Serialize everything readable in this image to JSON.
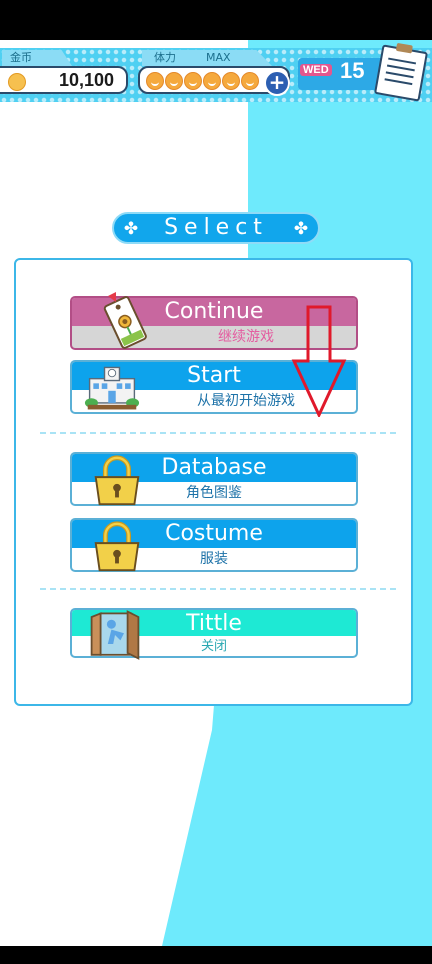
{
  "hud": {
    "coin_label": "金币",
    "coin_value": "10,100",
    "stamina_label": "体力",
    "stamina_max": "MAX",
    "stamina_filled": 6,
    "stamina_add": "+",
    "weekday": "WED",
    "day": "15",
    "memo_icon": "notepad-icon"
  },
  "select": {
    "title": "Select",
    "icon": "flower-icon"
  },
  "menu": {
    "continue_title": "Continue",
    "continue_sub": "继续游戏",
    "start_title": "Start",
    "start_sub": "从最初开始游戏",
    "database_title": "Database",
    "database_sub": "角色图鉴",
    "costume_title": "Costume",
    "costume_sub": "服装",
    "title_title": "Tittle",
    "title_sub": "关闭"
  },
  "colors": {
    "accent_blue": "#0da3ec",
    "continue_pink": "#c8679f",
    "title_teal": "#1ee9d4",
    "bg_cyan": "#6eeafc",
    "annotation_red": "#e0192b"
  }
}
